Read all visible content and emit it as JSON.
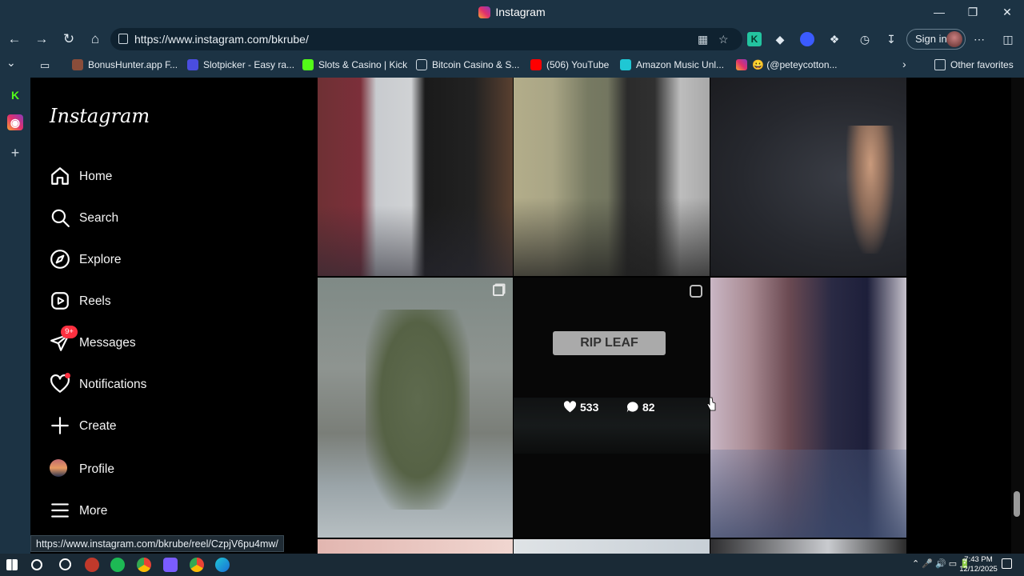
{
  "window": {
    "title": "Instagram"
  },
  "browser": {
    "url": "https://www.instagram.com/bkrube/",
    "signin_label": "Sign in",
    "favorites": [
      {
        "label": "BonusHunter.app F...",
        "color": "#8a4d3a"
      },
      {
        "label": "Slotpicker - Easy ra...",
        "color": "#4a4de0"
      },
      {
        "label": "Slots & Casino | Kick",
        "color": "#53fc18"
      },
      {
        "label": "Bitcoin Casino & S...",
        "color": "#1c3344"
      },
      {
        "label": "(506) YouTube",
        "color": "#ff0000"
      },
      {
        "label": "Amazon Music Unl...",
        "color": "#1fc7d4"
      },
      {
        "label": "😀 (@peteycotton...",
        "color": "#e1306c"
      }
    ],
    "other_favorites": "Other favorites"
  },
  "instagram": {
    "logo": "Instagram",
    "nav": [
      {
        "key": "home",
        "label": "Home"
      },
      {
        "key": "search",
        "label": "Search"
      },
      {
        "key": "explore",
        "label": "Explore"
      },
      {
        "key": "reels",
        "label": "Reels"
      },
      {
        "key": "messages",
        "label": "Messages",
        "badge": "9+"
      },
      {
        "key": "notifications",
        "label": "Notifications"
      },
      {
        "key": "create",
        "label": "Create"
      },
      {
        "key": "profile",
        "label": "Profile"
      },
      {
        "key": "more",
        "label": "More"
      }
    ],
    "hovered_post": {
      "caption_overlay": "RIP LEAF",
      "likes": "533",
      "comments": "82"
    }
  },
  "status_url": "https://www.instagram.com/bkrube/reel/CzpjV6pu4mw/",
  "taskbar": {
    "time": "7:43 PM",
    "date": "12/12/2025"
  },
  "colors": {
    "chrome": "#1c3344",
    "badge": "#ff3040",
    "background": "#000000"
  }
}
